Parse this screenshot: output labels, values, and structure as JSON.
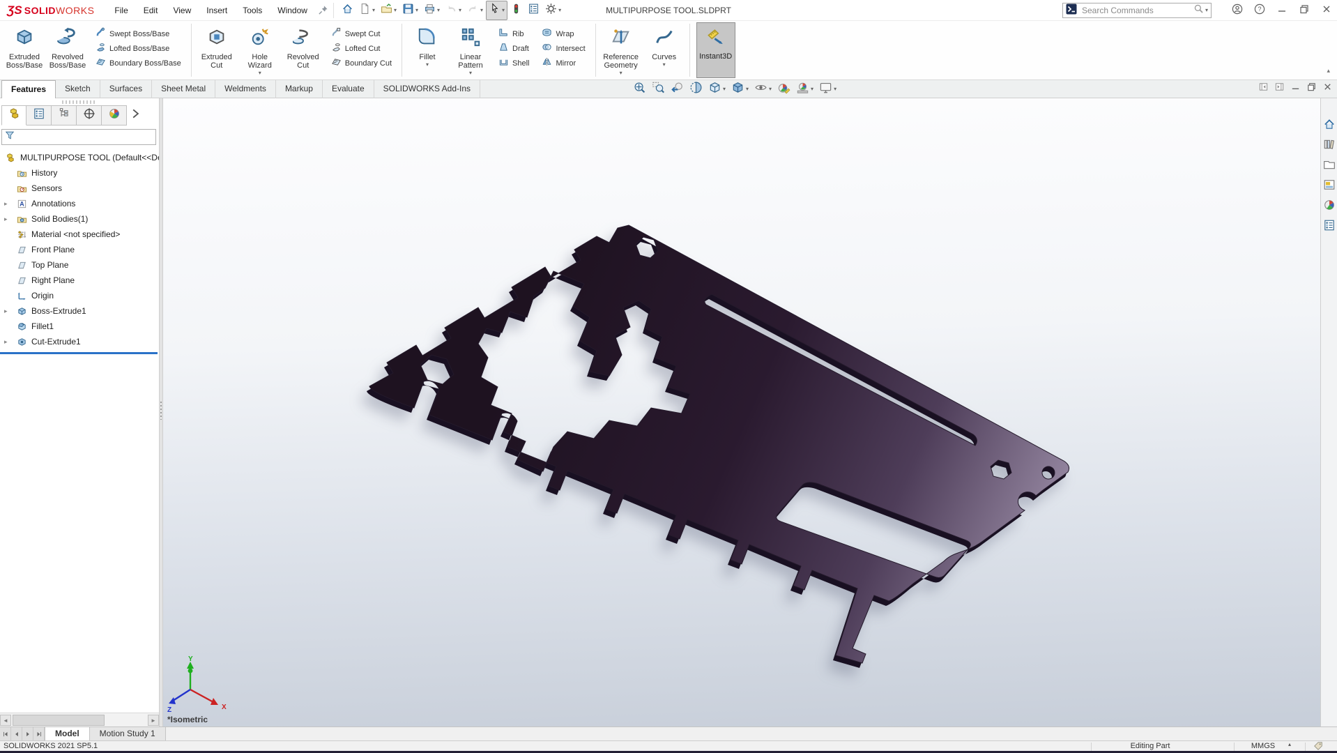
{
  "window": {
    "title": "MULTIPURPOSE TOOL.SLDPRT"
  },
  "logo": {
    "mark": "ƷS",
    "bold": "SOLID",
    "light": "WORKS"
  },
  "menus": [
    "File",
    "Edit",
    "View",
    "Insert",
    "Tools",
    "Window"
  ],
  "quickbar": [
    {
      "name": "home",
      "icon": "home"
    },
    {
      "name": "new-document",
      "icon": "doc-new",
      "caret": true
    },
    {
      "name": "open",
      "icon": "folder-open",
      "caret": true
    },
    {
      "name": "save",
      "icon": "save",
      "caret": true
    },
    {
      "name": "print",
      "icon": "print",
      "caret": true
    },
    {
      "name": "undo",
      "icon": "undo",
      "caret": true,
      "disabled": true
    },
    {
      "name": "redo",
      "icon": "redo",
      "caret": true,
      "disabled": true
    },
    {
      "name": "select",
      "icon": "cursor",
      "caret": true,
      "active": true
    },
    {
      "name": "rebuild",
      "icon": "rebuild"
    },
    {
      "name": "display-settings",
      "icon": "list-props"
    },
    {
      "name": "options",
      "icon": "gear",
      "caret": true
    }
  ],
  "search": {
    "placeholder": "Search Commands"
  },
  "titlebar_right": [
    {
      "name": "sign-in",
      "icon": "user"
    },
    {
      "name": "help",
      "icon": "help"
    },
    {
      "name": "minimize-window",
      "icon": "win-min"
    },
    {
      "name": "restore-window",
      "icon": "win-restore"
    },
    {
      "name": "close-window",
      "icon": "win-close"
    }
  ],
  "ribbon": {
    "groups": [
      {
        "large": [
          {
            "label": "Extruded Boss/Base",
            "icon": "boss-extrude"
          },
          {
            "label": "Revolved Boss/Base",
            "icon": "revolve-boss"
          }
        ],
        "smallcols": [
          [
            {
              "label": "Swept Boss/Base",
              "icon": "sweep-boss"
            },
            {
              "label": "Lofted Boss/Base",
              "icon": "loft-boss"
            },
            {
              "label": "Boundary Boss/Base",
              "icon": "boundary-boss"
            }
          ]
        ]
      },
      {
        "large": [
          {
            "label": "Extruded Cut",
            "icon": "extrude-cut"
          },
          {
            "label": "Hole Wizard",
            "icon": "hole-wizard",
            "caret": true
          },
          {
            "label": "Revolved Cut",
            "icon": "revolve-cut"
          }
        ],
        "smallcols": [
          [
            {
              "label": "Swept Cut",
              "icon": "sweep-cut"
            },
            {
              "label": "Lofted Cut",
              "icon": "loft-cut"
            },
            {
              "label": "Boundary Cut",
              "icon": "boundary-cut"
            }
          ]
        ]
      },
      {
        "large": [
          {
            "label": "Fillet",
            "icon": "fillet",
            "caret": true
          },
          {
            "label": "Linear Pattern",
            "icon": "linear-pattern",
            "caret": true
          }
        ],
        "smallcols": [
          [
            {
              "label": "Rib",
              "icon": "rib"
            },
            {
              "label": "Draft",
              "icon": "draft"
            },
            {
              "label": "Shell",
              "icon": "shell"
            }
          ],
          [
            {
              "label": "Wrap",
              "icon": "wrap"
            },
            {
              "label": "Intersect",
              "icon": "intersect"
            },
            {
              "label": "Mirror",
              "icon": "mirror"
            }
          ]
        ]
      },
      {
        "large": [
          {
            "label": "Reference Geometry",
            "icon": "reference-geometry",
            "caret": true
          },
          {
            "label": "Curves",
            "icon": "curves",
            "caret": true
          }
        ],
        "smallcols": []
      }
    ],
    "instant3d": {
      "label": "Instant3D",
      "icon": "instant3d",
      "active": true
    }
  },
  "command_tabs": [
    {
      "label": "Features",
      "active": true
    },
    {
      "label": "Sketch"
    },
    {
      "label": "Surfaces"
    },
    {
      "label": "Sheet Metal"
    },
    {
      "label": "Weldments"
    },
    {
      "label": "Markup"
    },
    {
      "label": "Evaluate"
    },
    {
      "label": "SOLIDWORKS Add-Ins"
    }
  ],
  "headsup": [
    {
      "name": "zoom-to-fit",
      "icon": "hud-fit"
    },
    {
      "name": "zoom-to-area",
      "icon": "hud-area"
    },
    {
      "name": "previous-view",
      "icon": "hud-prev"
    },
    {
      "name": "section-view",
      "icon": "hud-section"
    },
    {
      "name": "view-orientation",
      "icon": "hud-orient",
      "caret": true
    },
    {
      "name": "display-style",
      "icon": "hud-display",
      "caret": true
    },
    {
      "name": "hide-show-items",
      "icon": "hud-eye",
      "caret": true
    },
    {
      "name": "edit-appearance",
      "icon": "hud-appearance"
    },
    {
      "name": "apply-scene",
      "icon": "hud-scene",
      "caret": true
    },
    {
      "name": "view-settings",
      "icon": "hud-monitor",
      "caret": true
    }
  ],
  "doc_controls": [
    {
      "name": "collapse-pane-left",
      "icon": "pane-left"
    },
    {
      "name": "collapse-pane-right",
      "icon": "pane-right"
    },
    {
      "name": "minimize-document",
      "icon": "win-min"
    },
    {
      "name": "restore-document",
      "icon": "win-restore"
    },
    {
      "name": "close-document",
      "icon": "win-close"
    }
  ],
  "feature_manager": {
    "tabs": [
      {
        "name": "featuremanager-design-tree-tab",
        "icon": "fm-part",
        "active": true
      },
      {
        "name": "propertymanager-tab",
        "icon": "fm-pm"
      },
      {
        "name": "configurationmanager-tab",
        "icon": "fm-config"
      },
      {
        "name": "dimxpertmanager-tab",
        "icon": "fm-dimx"
      },
      {
        "name": "displaymanager-tab",
        "icon": "fm-display"
      },
      {
        "name": "expand-tabs",
        "icon": "chevron-right"
      }
    ],
    "root": "MULTIPURPOSE TOOL  (Default<<Def",
    "items": [
      {
        "label": "History",
        "icon": "folder-history"
      },
      {
        "label": "Sensors",
        "icon": "folder-sensors"
      },
      {
        "label": "Annotations",
        "icon": "annotations",
        "expandable": true
      },
      {
        "label": "Solid Bodies(1)",
        "icon": "solid-bodies",
        "expandable": true
      },
      {
        "label": "Material <not specified>",
        "icon": "material"
      },
      {
        "label": "Front Plane",
        "icon": "plane"
      },
      {
        "label": "Top Plane",
        "icon": "plane"
      },
      {
        "label": "Right Plane",
        "icon": "plane"
      },
      {
        "label": "Origin",
        "icon": "origin"
      },
      {
        "label": "Boss-Extrude1",
        "icon": "boss-extrude",
        "expandable": true
      },
      {
        "label": "Fillet1",
        "icon": "fillet-feature"
      },
      {
        "label": "Cut-Extrude1",
        "icon": "cut-extrude",
        "expandable": true
      }
    ]
  },
  "taskpane": [
    {
      "name": "home-tab",
      "icon": "tp-home"
    },
    {
      "name": "design-library",
      "icon": "tp-library"
    },
    {
      "name": "file-explorer",
      "icon": "tp-folder"
    },
    {
      "name": "view-palette",
      "icon": "tp-palette"
    },
    {
      "name": "appearances-scenes",
      "icon": "tp-appearance"
    },
    {
      "name": "custom-properties",
      "icon": "tp-props"
    }
  ],
  "viewport": {
    "view_label": "*Isometric",
    "triad": {
      "x": "X",
      "y": "Y",
      "z": "Z"
    },
    "model": {
      "name": "multipurpose tool card",
      "face_color_dark": "#1e1220",
      "face_color_light": "#988aa4"
    }
  },
  "bottom_tabs": [
    {
      "label": "Model",
      "active": true
    },
    {
      "label": "Motion Study 1"
    }
  ],
  "statusbar": {
    "left": "SOLIDWORKS 2021 SP5.1",
    "mode": "Editing Part",
    "units": "MMGS"
  },
  "colors": {
    "brand_red": "#d6001c",
    "accent_blue": "#2e6da4",
    "rollback_blue": "#2a72c8"
  }
}
